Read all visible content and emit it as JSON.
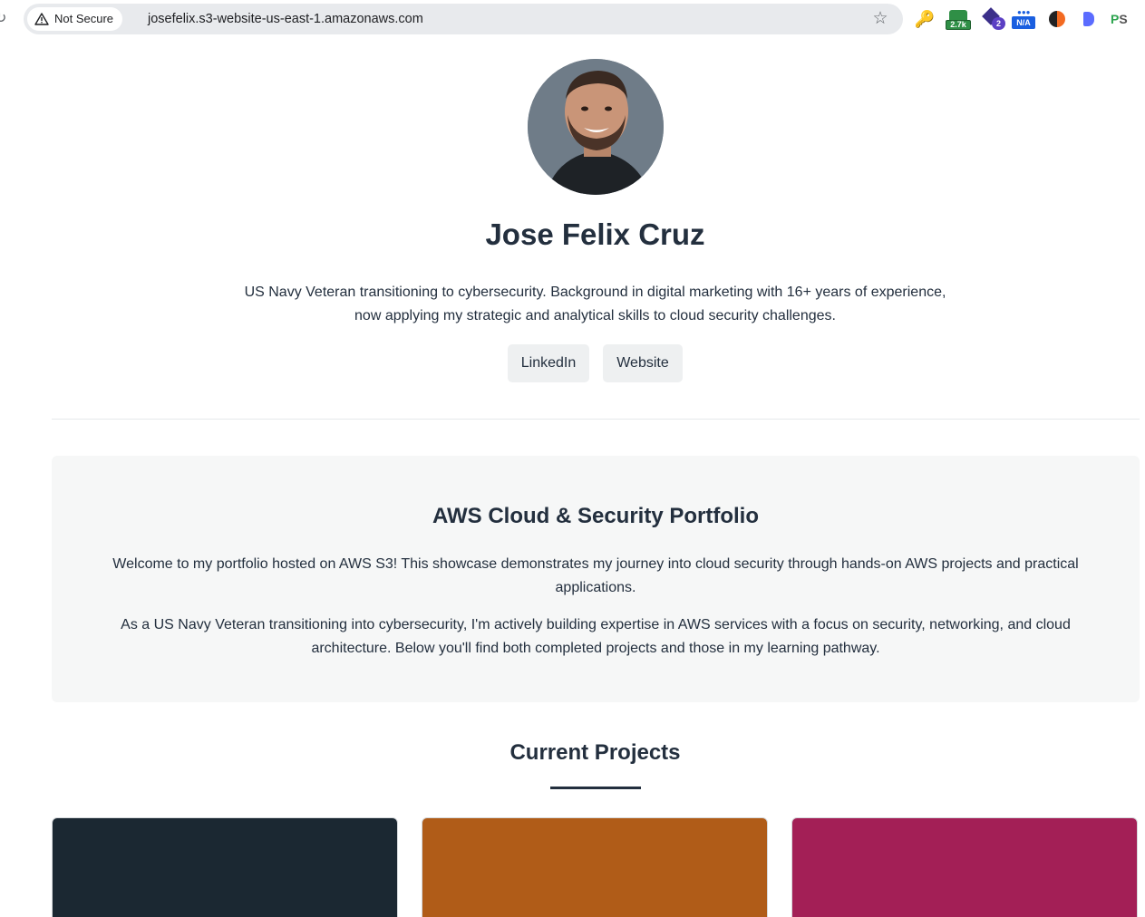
{
  "browser": {
    "reload_icon": "reload-icon",
    "security_label": "Not Secure",
    "url": "josefelix.s3-website-us-east-1.amazonaws.com",
    "extensions": {
      "lock_badge": "2.7k",
      "diamond_badge": "2",
      "na_badge": "N/A",
      "ps_p": "P",
      "ps_s": "S"
    }
  },
  "profile": {
    "name": "Jose Felix Cruz",
    "bio": "US Navy Veteran transitioning to cybersecurity. Background in digital marketing with 16+ years of experience, now applying my strategic and analytical skills to cloud security challenges.",
    "links": {
      "linkedin": "LinkedIn",
      "website": "Website"
    }
  },
  "intro": {
    "title": "AWS Cloud & Security Portfolio",
    "paragraph1": "Welcome to my portfolio hosted on AWS S3! This showcase demonstrates my journey into cloud security through hands-on AWS projects and practical applications.",
    "paragraph2": "As a US Navy Veteran transitioning into cybersecurity, I'm actively building expertise in AWS services with a focus on security, networking, and cloud architecture. Below you'll find both completed projects and those in my learning pathway."
  },
  "projects": {
    "title": "Current Projects",
    "cards": [
      {
        "color": "#1b2832"
      },
      {
        "color": "#b05c18"
      },
      {
        "color": "#a31f56"
      }
    ]
  },
  "colors": {
    "heading": "#232f3e",
    "intro_bg": "#f6f7f7",
    "button_bg": "#eef0f1"
  }
}
